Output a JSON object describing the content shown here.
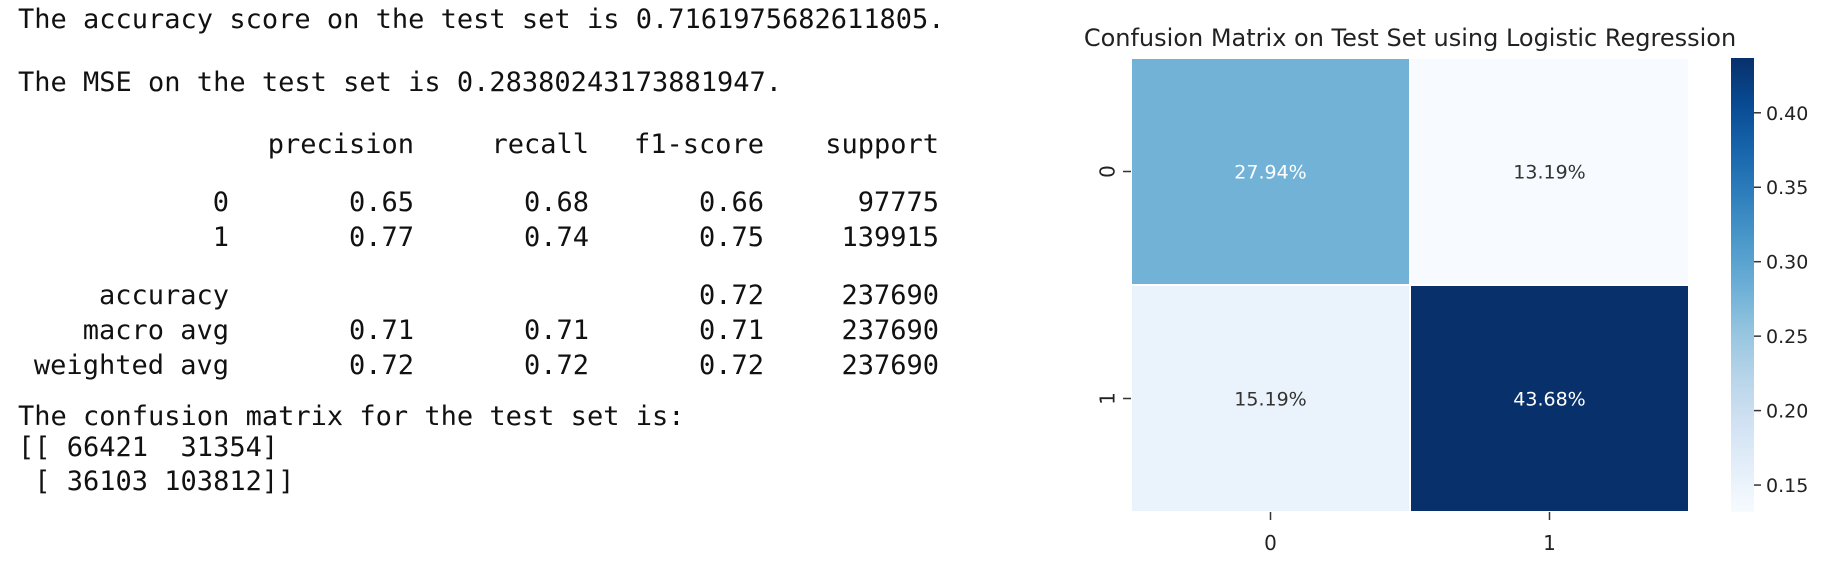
{
  "output": {
    "accuracy_line": "The accuracy score on the test set is 0.7161975682611805.",
    "mse_line": "The MSE on the test set is 0.28380243173881947.",
    "report": {
      "headers": [
        "",
        "precision",
        "recall",
        "f1-score",
        "support"
      ],
      "rows": [
        [
          "0",
          "0.65",
          "0.68",
          "0.66",
          "97775"
        ],
        [
          "1",
          "0.77",
          "0.74",
          "0.75",
          "139915"
        ],
        [
          "accuracy",
          "",
          "",
          "0.72",
          "237690"
        ],
        [
          "macro avg",
          "0.71",
          "0.71",
          "0.71",
          "237690"
        ],
        [
          "weighted avg",
          "0.72",
          "0.72",
          "0.72",
          "237690"
        ]
      ]
    },
    "confusion_label": "The confusion matrix for the test set is:",
    "confusion_rows": [
      "[[ 66421  31354]",
      " [ 36103 103812]]"
    ]
  },
  "chart_data": {
    "type": "heatmap",
    "title": "Confusion Matrix on Test Set using Logistic Regression",
    "x_ticks": [
      "0",
      "1"
    ],
    "y_ticks": [
      "0",
      "1"
    ],
    "values": [
      [
        0.2794,
        0.1319
      ],
      [
        0.1519,
        0.4368
      ]
    ],
    "annotations": [
      [
        "27.94%",
        "13.19%"
      ],
      [
        "15.19%",
        "43.68%"
      ]
    ],
    "colormap": "Blues",
    "colorbar": {
      "vmin": 0.1319,
      "vmax": 0.4368,
      "ticks": [
        "0.15",
        "0.20",
        "0.25",
        "0.30",
        "0.35",
        "0.40"
      ]
    }
  }
}
